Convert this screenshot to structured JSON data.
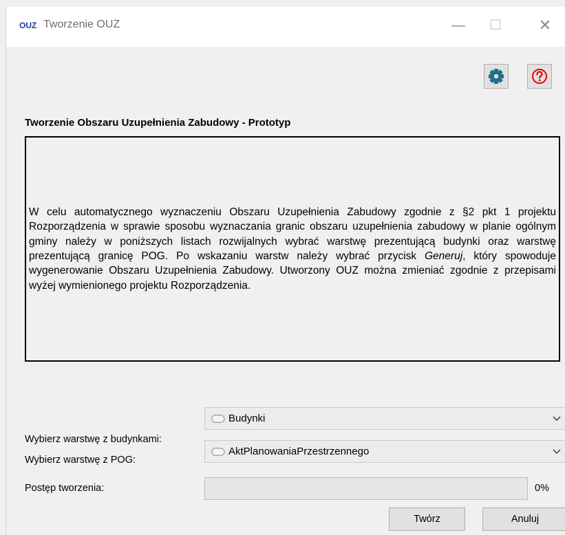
{
  "window": {
    "logo_text": "OUZ",
    "title": "Tworzenie OUZ",
    "minimize_glyph": "—",
    "maximize_glyph": "☐",
    "close_glyph": "✕"
  },
  "toolbar": {
    "settings_icon": "gear-icon",
    "help_icon": "question-circle-icon",
    "accent_settings": "#1f6f8b",
    "accent_help": "#e00000"
  },
  "heading": "Tworzenie Obszaru Uzupełnienia Zabudowy - Prototyp",
  "description": {
    "part1": "W celu automatycznego wyznaczeniu Obszaru Uzupełnienia Zabudowy zgodnie z §2 pkt 1 projektu Rozporządzenia w sprawie sposobu wyznaczania granic obszaru uzupełnienia zabudowy w planie ogólnym gminy należy w poniższych listach rozwijalnych wybrać warstwę prezentującą budynki oraz warstwę prezentującą granicę POG. Po wskazaniu warstw należy wybrać przycisk ",
    "emphasis": "Generuj",
    "part2": ", który spowoduje wygenerowanie Obszaru Uzupełnienia Zabudowy. Utworzony OUZ można zmieniać zgodnie z przepisami wyżej wymienionego projektu Rozporządzenia."
  },
  "form": {
    "buildings_label": "Wybierz warstwę z budynkami:",
    "buildings_value": "Budynki",
    "pog_label": "Wybierz warstwę z POG:",
    "pog_value": "AktPlanowaniaPrzestrzennego",
    "progress_label": "Postęp tworzenia:",
    "progress_value": 0,
    "progress_text": "0%"
  },
  "buttons": {
    "create": "Twórz",
    "cancel": "Anuluj"
  }
}
